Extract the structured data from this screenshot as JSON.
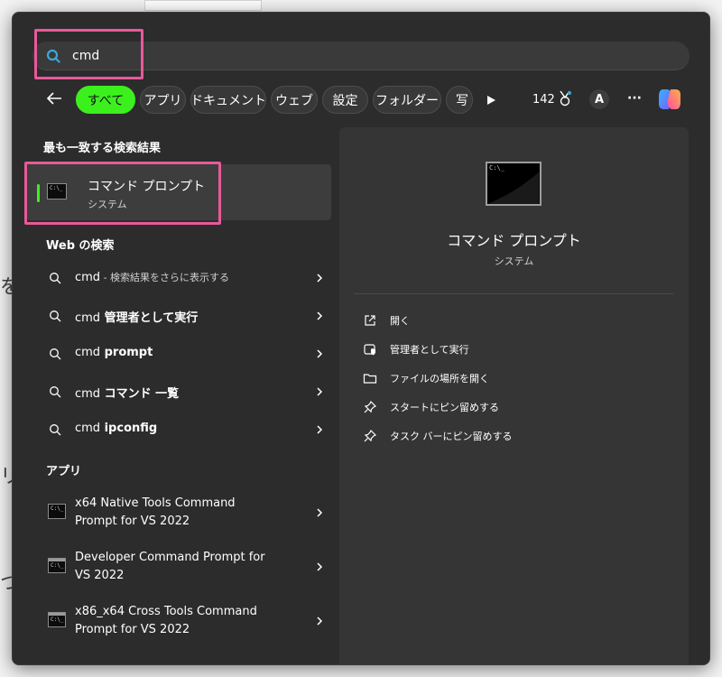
{
  "search": {
    "value": "cmd",
    "placeholder": ""
  },
  "filters": {
    "chips": [
      {
        "label": "すべて"
      },
      {
        "label": "アプリ"
      },
      {
        "label": "ドキュメント"
      },
      {
        "label": "ウェブ"
      },
      {
        "label": "設定"
      },
      {
        "label": "フォルダー"
      },
      {
        "label": "写"
      }
    ],
    "points": "142",
    "account_initial": "A",
    "more": "···"
  },
  "best_match": {
    "section": "最も一致する検索結果",
    "title": "コマンド プロンプト",
    "subtitle": "システム"
  },
  "web": {
    "section": "Web の検索",
    "items": [
      {
        "query": "cmd",
        "suffix": " - 検索結果をさらに表示する"
      },
      {
        "query": "cmd",
        "suffix": " 管理者として実行"
      },
      {
        "query": "cmd",
        "suffix": " prompt"
      },
      {
        "query": "cmd",
        "suffix": " コマンド 一覧"
      },
      {
        "query": "cmd",
        "suffix": " ipconfig"
      }
    ]
  },
  "apps": {
    "section": "アプリ",
    "items": [
      {
        "line1": "x64 Native Tools Command",
        "line2": "Prompt for VS 2022"
      },
      {
        "line1": "Developer Command Prompt for",
        "line2": "VS 2022"
      },
      {
        "line1": "x86_x64 Cross Tools Command",
        "line2": "Prompt for VS 2022"
      }
    ]
  },
  "detail": {
    "title": "コマンド プロンプト",
    "subtitle": "システム",
    "actions": [
      {
        "label": "開く",
        "icon": "open-external-icon"
      },
      {
        "label": "管理者として実行",
        "icon": "admin-shield-icon"
      },
      {
        "label": "ファイルの場所を開く",
        "icon": "folder-icon"
      },
      {
        "label": "スタートにピン留めする",
        "icon": "pin-icon"
      },
      {
        "label": "タスク バーにピン留めする",
        "icon": "pin-icon"
      }
    ]
  },
  "background": {
    "chars": [
      "を",
      "リ",
      "つ"
    ]
  },
  "icon_text": {
    "prompt": "C:\\_"
  },
  "colors": {
    "accent_green": "#3cf01e",
    "highlight_pink": "#e8599a",
    "panel": "#2c2c2c"
  }
}
